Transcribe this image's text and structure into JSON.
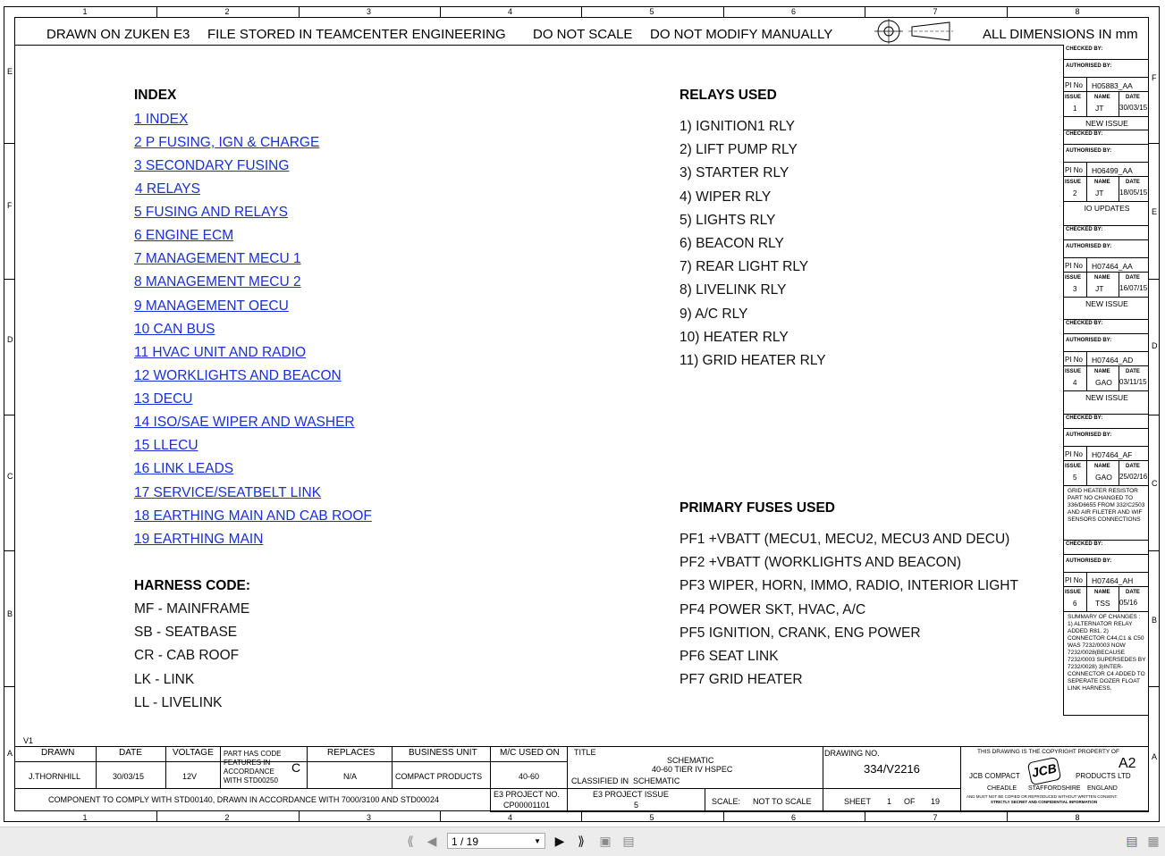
{
  "header_bar": {
    "drawn_on": "DRAWN ON ZUKEN E3",
    "file_stored": "FILE STORED IN TEAMCENTER ENGINEERING",
    "do_not_scale": "DO NOT SCALE",
    "do_not_modify": "DO NOT MODIFY MANUALLY",
    "dimensions": "ALL DIMENSIONS IN mm"
  },
  "grid": {
    "columns_top": [
      "1",
      "2",
      "3",
      "4",
      "5",
      "6",
      "7",
      "8"
    ],
    "columns_bottom": [
      "1",
      "2",
      "3",
      "4",
      "5",
      "6",
      "7",
      "8"
    ],
    "rows_left": [
      "E",
      "F",
      "D",
      "C",
      "B",
      "A"
    ],
    "rows_right": [
      "F",
      "E",
      "D",
      "C",
      "B",
      "A"
    ]
  },
  "index": {
    "title": "INDEX",
    "items": [
      "1 INDEX",
      "2 P FUSING, IGN & CHARGE",
      "3 SECONDARY FUSING",
      "4 RELAYS",
      "5 FUSING AND RELAYS",
      "6 ENGINE ECM",
      "7 MANAGEMENT MECU 1",
      "8 MANAGEMENT MECU 2",
      "9 MANAGEMENT OECU ",
      "10 CAN BUS",
      "11 HVAC UNIT AND RADIO",
      "12 WORKLIGHTS AND BEACON",
      "13 DECU",
      "14 ISO/SAE WIPER AND WASHER",
      "15 LLECU",
      "16 LINK LEADS",
      "17 SERVICE/SEATBELT LINK",
      "18 EARTHING MAIN AND CAB ROOF",
      "19 EARTHING MAIN"
    ]
  },
  "harness": {
    "title": "HARNESS CODE:",
    "items": [
      "MF - MAINFRAME",
      "SB - SEATBASE",
      "CR - CAB ROOF",
      "LK - LINK",
      "LL - LIVELINK"
    ]
  },
  "relays": {
    "title": "RELAYS USED",
    "items": [
      "1) IGNITION1 RLY",
      "2) LIFT PUMP RLY",
      "3) STARTER RLY",
      "4) WIPER RLY",
      "5) LIGHTS RLY",
      "6) BEACON RLY",
      "7) REAR LIGHT RLY",
      "8) LIVELINK RLY",
      "9) A/C RLY",
      "10) HEATER RLY",
      "11) GRID HEATER RLY"
    ]
  },
  "fuses": {
    "title": "PRIMARY FUSES USED",
    "items": [
      "PF1 +VBATT (MECU1, MECU2, MECU3 AND DECU)",
      "PF2 +VBATT (WORKLIGHTS AND BEACON)",
      "PF3 WIPER, HORN, IMMO, RADIO, INTERIOR LIGHT",
      "PF4 POWER SKT, HVAC, A/C",
      "PF5 IGNITION, CRANK, ENG POWER",
      "PF6 SEAT LINK",
      "PF7 GRID HEATER"
    ]
  },
  "revisions": {
    "checked_label": "CHECKED BY:",
    "authorised_label": "AUTHORISED BY:",
    "pi_label": "PI No",
    "issue_label": "ISSUE",
    "name_label": "NAME",
    "date_label": "DATE",
    "entries": [
      {
        "pi": "H05883_AA",
        "issue": "1",
        "name": "JT",
        "date": "30/03/15",
        "desc": "NEW ISSUE"
      },
      {
        "pi": "H06499_AA",
        "issue": "2",
        "name": "JT",
        "date": "18/05/15",
        "desc": "IO UPDATES"
      },
      {
        "pi": "H07464_AA",
        "issue": "3",
        "name": "JT",
        "date": "16/07/15",
        "desc": "NEW ISSUE"
      },
      {
        "pi": "H07464_AD",
        "issue": "4",
        "name": "GAO",
        "date": "03/11/15",
        "desc": "NEW ISSUE"
      },
      {
        "pi": "H07464_AF",
        "issue": "5",
        "name": "GAO",
        "date": "25/02/16",
        "desc": "GRID HEATER RESISTOR PART NO CHANGED TO 336/D6655 FROM 332/C2503 AND AIR FILETER AND WIF SENSORS CONNECTIONS PROVIDED TO ENG ECU"
      },
      {
        "pi": "H07464_AH",
        "issue": "6",
        "name": "TSS",
        "date": "05/16",
        "desc": "SUMMARY OF CHANGES : 1) ALTERNATOR RELAY ADDED R81. 2) CONNECTOR C44,C1 & C50 WAS 7232/0003 NOW 7232/0028(BECAUSE 7232/0003 SUPERSEDES BY 7232/0028) 3)INTER-CONNECTOR C4 ADDED TO SEPERATE DOZER FLOAT LINK HARNESS."
      }
    ]
  },
  "title_block": {
    "version": "V1",
    "drawn_label": "DRAWN",
    "drawn_value": "J.THORNHILL",
    "date_label": "DATE",
    "date_value": "30/03/15",
    "voltage_label": "VOLTAGE",
    "voltage_value": "12V",
    "code_note": "PART HAS CODE FEATURES IN ACCORDANCE WITH STD00250",
    "code_letter": "C",
    "replaces_label": "REPLACES",
    "replaces_value": "N/A",
    "business_label": "BUSINESS UNIT",
    "business_value": "COMPACT PRODUCTS",
    "mc_label": "M/C USED ON",
    "mc_value": "40-60",
    "title_label": "TITLE",
    "title_line1": "SCHEMATIC",
    "title_line2": "40-60 TIER IV HSPEC",
    "classified_label": "CLASSIFIED IN",
    "classified_value": "SCHEMATIC",
    "drawing_no_label": "DRAWING NO.",
    "drawing_no": "334/V2216",
    "copyright": "THIS DRAWING IS THE COPYRIGHT PROPERTY OF",
    "company1": "JCB COMPACT",
    "company2": "PRODUCTS LTD",
    "logo": "JCB",
    "location1": "CHEADLE",
    "location2": "STAFFORDSHIRE",
    "location3": "ENGLAND",
    "size": "A2",
    "secret1": "AND MUST NOT BE COPIED OR REPRODUCED WITHOUT WRITTEN CONSENT.",
    "secret2": "STRICTLY SECRET AND CONFIDENTIAL INFORMATION",
    "comply": "COMPONENT TO COMPLY WITH STD00140, DRAWN IN ACCORDANCE WITH 7000/3100 AND STD00024",
    "e3_label": "E3 PROJECT NO.",
    "e3_value": "CP00001101",
    "e3_issue_label": "E3 PROJECT ISSUE",
    "e3_issue_value": "5",
    "scale_label": "SCALE:",
    "scale_value": "NOT TO SCALE",
    "sheet_label": "SHEET",
    "sheet_value": "1",
    "of_label": "OF",
    "of_value": "19"
  },
  "viewer": {
    "page_indicator": "1 / 19"
  }
}
